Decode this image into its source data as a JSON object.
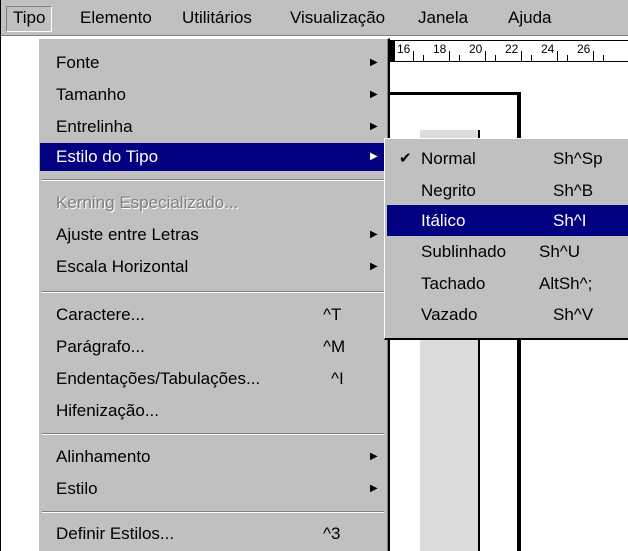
{
  "menubar": {
    "items": [
      {
        "label": "Tipo",
        "active": true
      },
      {
        "label": "Elemento",
        "active": false
      },
      {
        "label": "Utilitários",
        "active": false
      },
      {
        "label": "Visualização",
        "active": false
      },
      {
        "label": "Janela",
        "active": false
      },
      {
        "label": "Ajuda",
        "active": false
      }
    ]
  },
  "ruler": {
    "numbers": [
      "16",
      "18",
      "20",
      "22",
      "24",
      "26"
    ]
  },
  "menu": {
    "items": [
      {
        "label": "Fonte",
        "shortcut": "",
        "submenu": true
      },
      {
        "label": "Tamanho",
        "shortcut": "",
        "submenu": true
      },
      {
        "label": "Entrelinha",
        "shortcut": "",
        "submenu": true
      },
      {
        "label": "Estilo do Tipo",
        "shortcut": "",
        "submenu": true,
        "selected": true
      },
      {
        "label": "Kerning Especializado...",
        "shortcut": "",
        "submenu": false,
        "disabled": true
      },
      {
        "label": "Ajuste entre Letras",
        "shortcut": "",
        "submenu": true
      },
      {
        "label": "Escala Horizontal",
        "shortcut": "",
        "submenu": true
      },
      {
        "label": "Caractere...",
        "shortcut": "^T",
        "submenu": false
      },
      {
        "label": "Parágrafo...",
        "shortcut": "^M",
        "submenu": false
      },
      {
        "label": "Endentações/Tabulações...",
        "shortcut": "^I",
        "submenu": false
      },
      {
        "label": "Hifenização...",
        "shortcut": "",
        "submenu": false
      },
      {
        "label": "Alinhamento",
        "shortcut": "",
        "submenu": true
      },
      {
        "label": "Estilo",
        "shortcut": "",
        "submenu": true
      },
      {
        "label": "Definir Estilos...",
        "shortcut": "^3",
        "submenu": false
      }
    ]
  },
  "submenu": {
    "items": [
      {
        "label": "Normal",
        "shortcut": "Sh^Sp",
        "checked": true
      },
      {
        "label": "Negrito",
        "shortcut": "Sh^B",
        "checked": false
      },
      {
        "label": "Itálico",
        "shortcut": "Sh^I",
        "checked": false,
        "selected": true
      },
      {
        "label": "Sublinhado",
        "shortcut": "Sh^U",
        "checked": false
      },
      {
        "label": "Tachado",
        "shortcut": "AltSh^;",
        "checked": false
      },
      {
        "label": "Vazado",
        "shortcut": "Sh^V",
        "checked": false
      }
    ]
  },
  "icons": {
    "submenu_arrow": "▶",
    "checkmark": "✔"
  },
  "colors": {
    "menu_bg": "#c0c0c0",
    "highlight": "#000080",
    "highlight_text": "#ffffff",
    "disabled_text": "#808080"
  }
}
